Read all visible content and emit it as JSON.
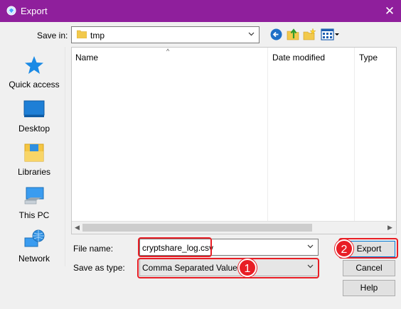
{
  "window": {
    "title": "Export",
    "close_glyph": "✕"
  },
  "save_in": {
    "label": "Save in:",
    "value": "tmp"
  },
  "toolbar": {
    "icons": [
      "back-icon",
      "up-folder-icon",
      "new-folder-icon",
      "views-menu-icon"
    ]
  },
  "places": [
    {
      "label": "Quick access",
      "icon": "quick-access-star-icon"
    },
    {
      "label": "Desktop",
      "icon": "desktop-icon"
    },
    {
      "label": "Libraries",
      "icon": "libraries-icon"
    },
    {
      "label": "This PC",
      "icon": "this-pc-icon"
    },
    {
      "label": "Network",
      "icon": "network-icon"
    }
  ],
  "file_list": {
    "columns": [
      "Name",
      "Date modified",
      "Type"
    ],
    "sort_glyph": "^",
    "rows": []
  },
  "file_name": {
    "label": "File name:",
    "value": "cryptshare_log.csv"
  },
  "save_as_type": {
    "label": "Save as type:",
    "value": "Comma Separated Value"
  },
  "buttons": {
    "export": "Export",
    "cancel": "Cancel",
    "help": "Help"
  },
  "annotations": {
    "badge1": "1",
    "badge2": "2",
    "color": "#e81e25"
  },
  "colors": {
    "titlebar": "#8f1f9c",
    "accent": "#0078d7"
  }
}
